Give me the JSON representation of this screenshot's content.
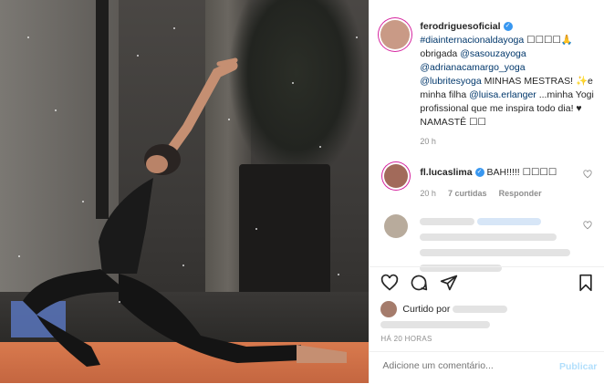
{
  "post": {
    "author": "ferodriguesoficial",
    "caption": {
      "hashtag": "#diainternacionaldayoga",
      "emoji_tail": "☐☐☐☐🙏",
      "text1": "obrigada",
      "mention1": "@sasouzayoga",
      "mention2": "@adrianacamargo_yoga",
      "mention3": "@lubritesyoga",
      "text2": "MINHAS MESTRAS! ✨e minha filha",
      "mention4": "@luisa.erlanger",
      "text3": "...minha Yogi profissional que me inspira todo dia! ♥ NAMASTÊ ☐☐"
    },
    "caption_time": "20 h"
  },
  "comments": [
    {
      "author": "fl.lucaslima",
      "text": "BAH!!!!! ☐☐☐☐",
      "time": "20 h",
      "likes": "7 curtidas",
      "reply": "Responder"
    }
  ],
  "likes_label": "Curtido por",
  "timestamp": "HÁ 20 HORAS",
  "add_comment": {
    "placeholder": "Adicione um comentário...",
    "publish": "Publicar"
  },
  "icons": {
    "like": "heart-icon",
    "comment": "comment-icon",
    "share": "share-icon",
    "save": "bookmark-icon",
    "verified": "verified-badge-icon"
  },
  "colors": {
    "link": "#00376b",
    "verified": "#3897f0",
    "publish": "#b2dffc",
    "muted": "#8e8e8e"
  }
}
